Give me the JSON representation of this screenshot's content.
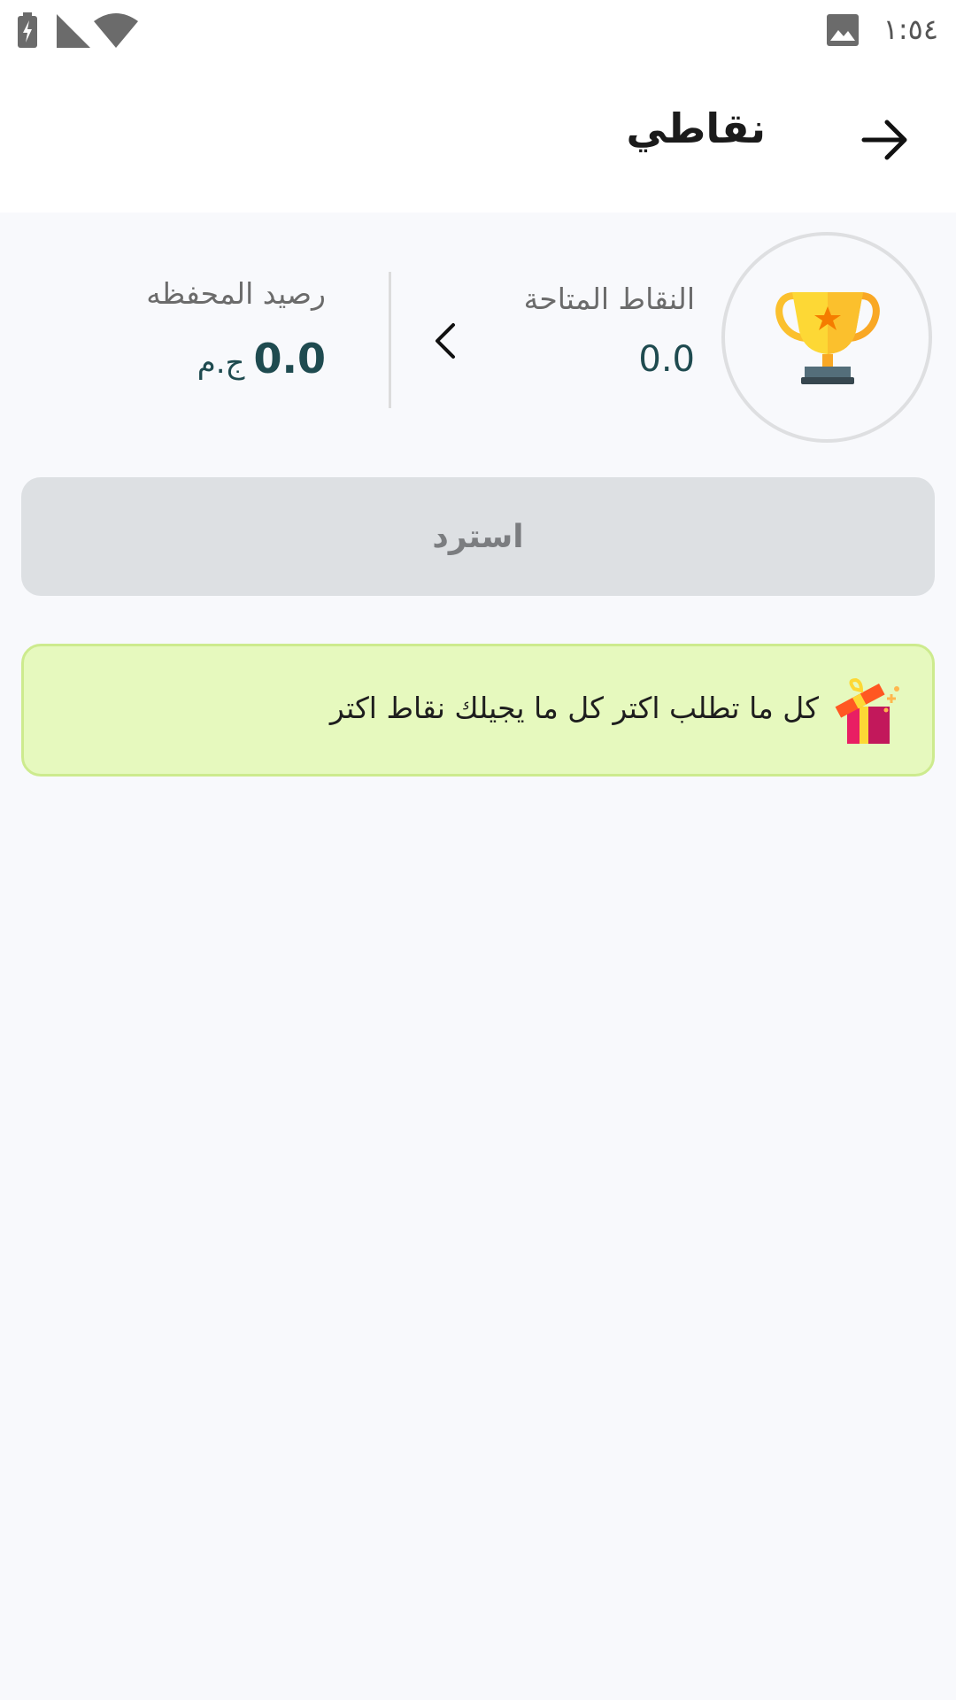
{
  "status_bar": {
    "time": "١:٥٤",
    "icons": [
      "image-icon",
      "wifi-icon",
      "signal-icon",
      "battery-charging-icon"
    ]
  },
  "app_bar": {
    "title": "نقاطي",
    "back_icon": "arrow-right-icon"
  },
  "points_summary": {
    "trophy_icon": "trophy-icon",
    "available_points_label": "النقاط المتاحة",
    "available_points_value": "0.0",
    "chevron_icon": "chevron-left-icon",
    "wallet_label": "رصيد المحفظه",
    "wallet_amount": "0.0",
    "wallet_currency": "ج.م"
  },
  "redeem_button": {
    "label": "استرد"
  },
  "info_banner": {
    "icon": "gift-icon",
    "text": "كل ما تطلب اكتر كل ما يجيلك نقاط اكتر"
  },
  "colors": {
    "background": "#f8f9fc",
    "accent_text": "#1f4b50",
    "redeem_disabled_bg": "#dde0e3",
    "banner_bg": "#e6f9be",
    "banner_border": "#cdeb8e",
    "trophy_gold": "#fbc02d"
  }
}
